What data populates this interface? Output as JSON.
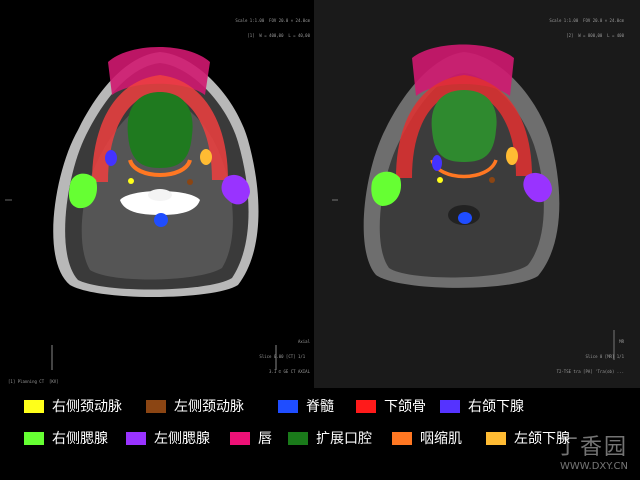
{
  "left_panel": {
    "top_right_lines": [
      "Scale 1:1.00  FOV 20.0 × 24.0cm",
      "[1]  W = 400,00  L = 40,00"
    ],
    "bottom_left": "[1] Planning CT  [KV]",
    "bottom_right_lines": [
      "Axial",
      "Slice 0.00 [CT] 1/1  ",
      "3.1 © GE CT AXIAL"
    ]
  },
  "right_panel": {
    "top_right_lines": [
      "Scale 1:1.00  FOV 20.0 × 24.0cm",
      "[2]  W = 800,00  L = 400"
    ],
    "bottom_right_lines": [
      "MR",
      "Slice 0 [MR] 1/1",
      "T2-TSE tra [PA] 'Tra(ob) ..."
    ]
  },
  "legend": {
    "items": [
      {
        "label": "右侧颈动脉",
        "color": "#ffff1a"
      },
      {
        "label": "左侧颈动脉",
        "color": "#8b4513"
      },
      {
        "label": "脊髓",
        "color": "#1f4dff"
      },
      {
        "label": "下颌骨",
        "color": "#ff1a1a"
      },
      {
        "label": "右颌下腺",
        "color": "#5533ff"
      },
      {
        "label": "右侧腮腺",
        "color": "#66ff33"
      },
      {
        "label": "左侧腮腺",
        "color": "#9933ff"
      },
      {
        "label": "唇",
        "color": "#ee1177"
      },
      {
        "label": "扩展口腔",
        "color": "#1a7a1a"
      },
      {
        "label": "咽缩肌",
        "color": "#ff7722"
      },
      {
        "label": "左颌下腺",
        "color": "#ffbb33"
      }
    ]
  },
  "watermark": {
    "brand": "丁香园",
    "url": "WWW.DXY.CN"
  }
}
